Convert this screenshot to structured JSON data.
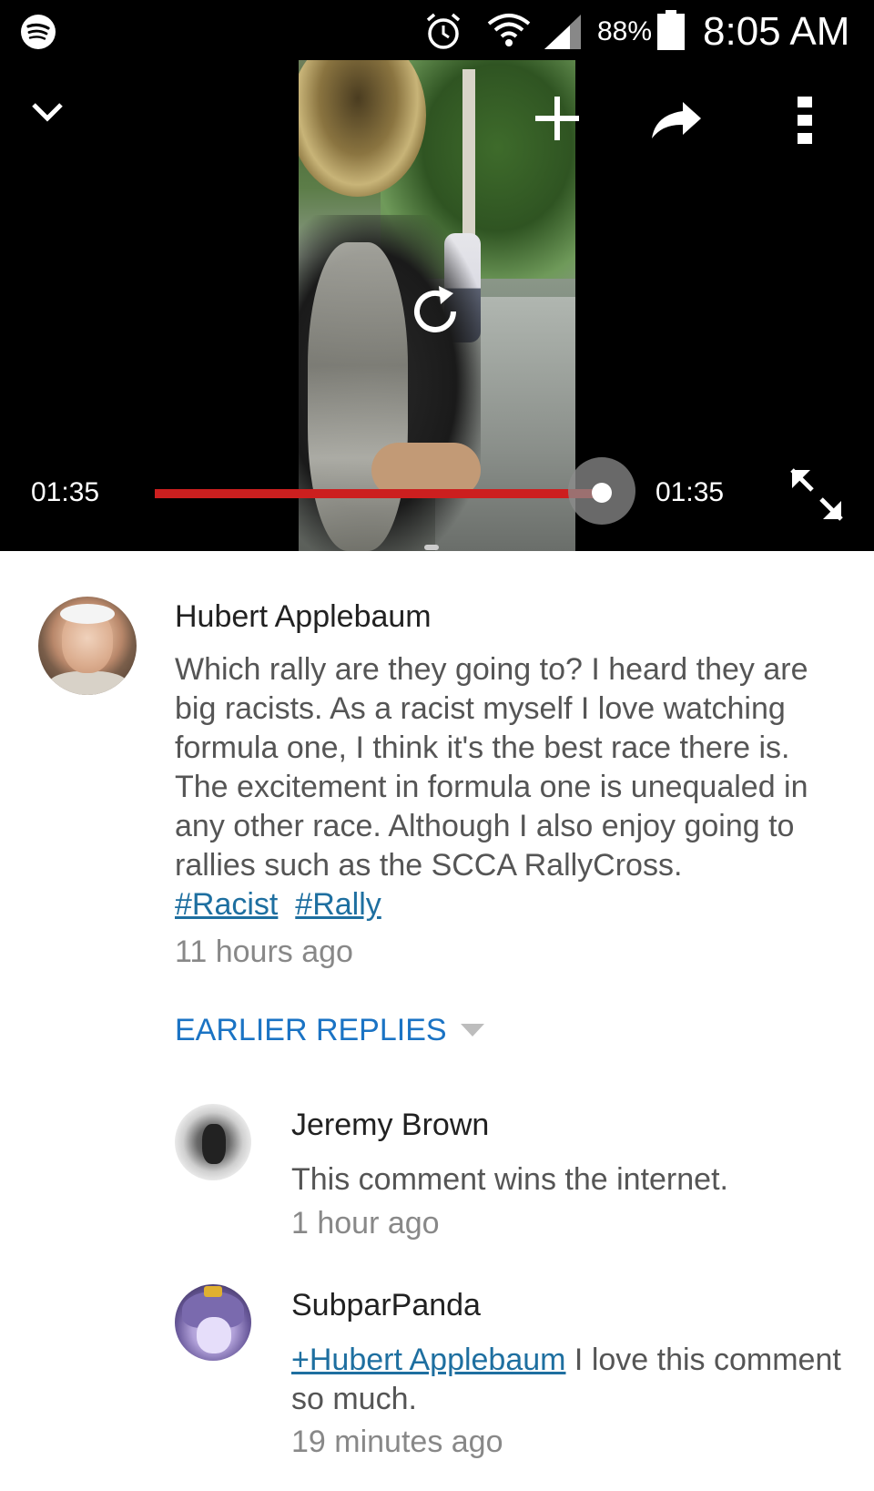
{
  "status_bar": {
    "battery_percent": "88%",
    "time": "8:05 AM",
    "icons": [
      "spotify-icon",
      "alarm-icon",
      "wifi-icon",
      "signal-icon",
      "battery-icon"
    ]
  },
  "player": {
    "current_time": "01:35",
    "total_time": "01:35",
    "progress": 1.0,
    "progress_color": "#cc1f1f",
    "controls": [
      "collapse-icon",
      "add-to-playlist-icon",
      "share-icon",
      "more-options-icon",
      "replay-icon",
      "fullscreen-icon"
    ]
  },
  "comment": {
    "author": "Hubert Applebaum",
    "text": "Which rally are they going to? I heard they are big racists.  As a racist myself I love watching formula one, I think it's the best race there is. The excitement in formula one is unequaled in any other race. Although I also enjoy going to rallies such as the SCCA RallyCross.",
    "hashtags": [
      "#Racist",
      "#Rally"
    ],
    "time": "11 hours ago"
  },
  "earlier_replies_label": "EARLIER REPLIES",
  "replies": [
    {
      "author": "Jeremy Brown",
      "text": "This comment wins the internet.",
      "time": "1 hour ago"
    },
    {
      "author": "SubparPanda",
      "mention": "+Hubert Applebaum",
      "text": " I love this comment so much.",
      "time": "19 minutes ago"
    }
  ],
  "colors": {
    "link": "#1e6fa0",
    "earlier_replies": "#1a73c4",
    "author": "#212121",
    "body_text": "#555555",
    "timestamp": "#888888"
  }
}
